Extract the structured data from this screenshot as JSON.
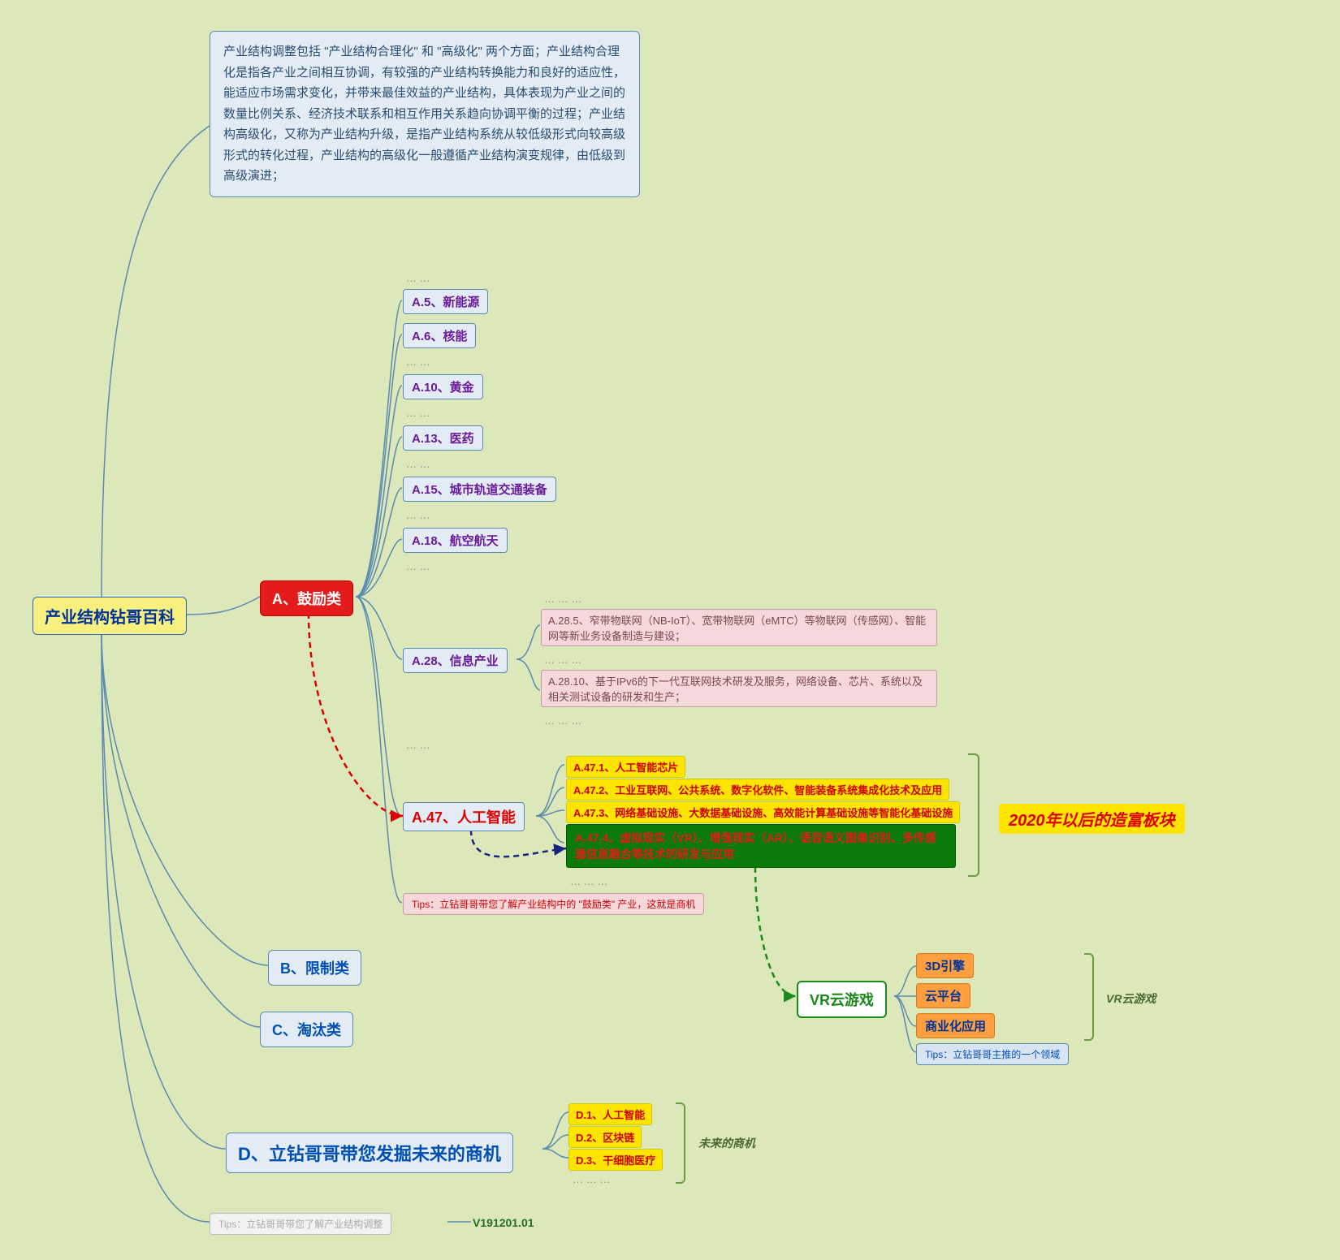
{
  "root": {
    "label": "产业结构钻哥百科"
  },
  "description": "产业结构调整包括 \"产业结构合理化\" 和 \"高级化\" 两个方面；产业结构合理化是指各产业之间相互协调，有较强的产业结构转换能力和良好的适应性，能适应市场需求变化，并带来最佳效益的产业结构，具体表现为产业之间的数量比例关系、经济技术联系和相互作用关系趋向协调平衡的过程；产业结构高级化，又称为产业结构升级，是指产业结构系统从较低级形式向较高级形式的转化过程，产业结构的高级化一般遵循产业结构演变规律，由低级到高级演进；",
  "catA": {
    "label": "A、鼓励类",
    "items": {
      "a5": "A.5、新能源",
      "a6": "A.6、核能",
      "a10": "A.10、黄金",
      "a13": "A.13、医药",
      "a15": "A.15、城市轨道交通装备",
      "a18": "A.18、航空航天",
      "a28": {
        "label": "A.28、信息产业",
        "sub1": "A.28.5、窄带物联网（NB-IoT）、宽带物联网（eMTC）等物联网（传感网）、智能网等新业务设备制造与建设；",
        "sub2": "A.28.10、基于IPv6的下一代互联网技术研发及服务，网络设备、芯片、系统以及相关测试设备的研发和生产；"
      },
      "a47": {
        "label": "A.47、人工智能",
        "sub1": "A.47.1、人工智能芯片",
        "sub2": "A.47.2、工业互联网、公共系统、数字化软件、智能装备系统集成化技术及应用",
        "sub3": "A.47.3、网络基础设施、大数据基础设施、高效能计算基础设施等智能化基础设施",
        "sub4": "A.47.4、虚拟现实（VR）、增强现实（AR）、语音语义图像识别、多传感器信息融合等技术的研发与应用"
      }
    },
    "tips": "Tips：立钻哥哥带您了解产业结构中的 \"鼓励类\" 产业，这就是商机",
    "annot": "2020年以后的造富板块"
  },
  "catB": {
    "label": "B、限制类"
  },
  "catC": {
    "label": "C、淘汰类"
  },
  "catD": {
    "label": "D、立钻哥哥带您发掘未来的商机",
    "items": {
      "d1": "D.1、人工智能",
      "d2": "D.2、区块链",
      "d3": "D.3、干细胞医疗"
    },
    "annot": "未来的商机"
  },
  "vr": {
    "label": "VR云游戏",
    "items": {
      "v1": "3D引擎",
      "v2": "云平台",
      "v3": "商业化应用"
    },
    "tips": "Tips：立钻哥哥主推的一个领域",
    "annot": "VR云游戏"
  },
  "footer": {
    "tips": "Tips：立钻哥哥带您了解产业结构调整",
    "version": "V191201.01"
  },
  "ellipsis": "…  …",
  "ellipsis2": "…  …  …"
}
